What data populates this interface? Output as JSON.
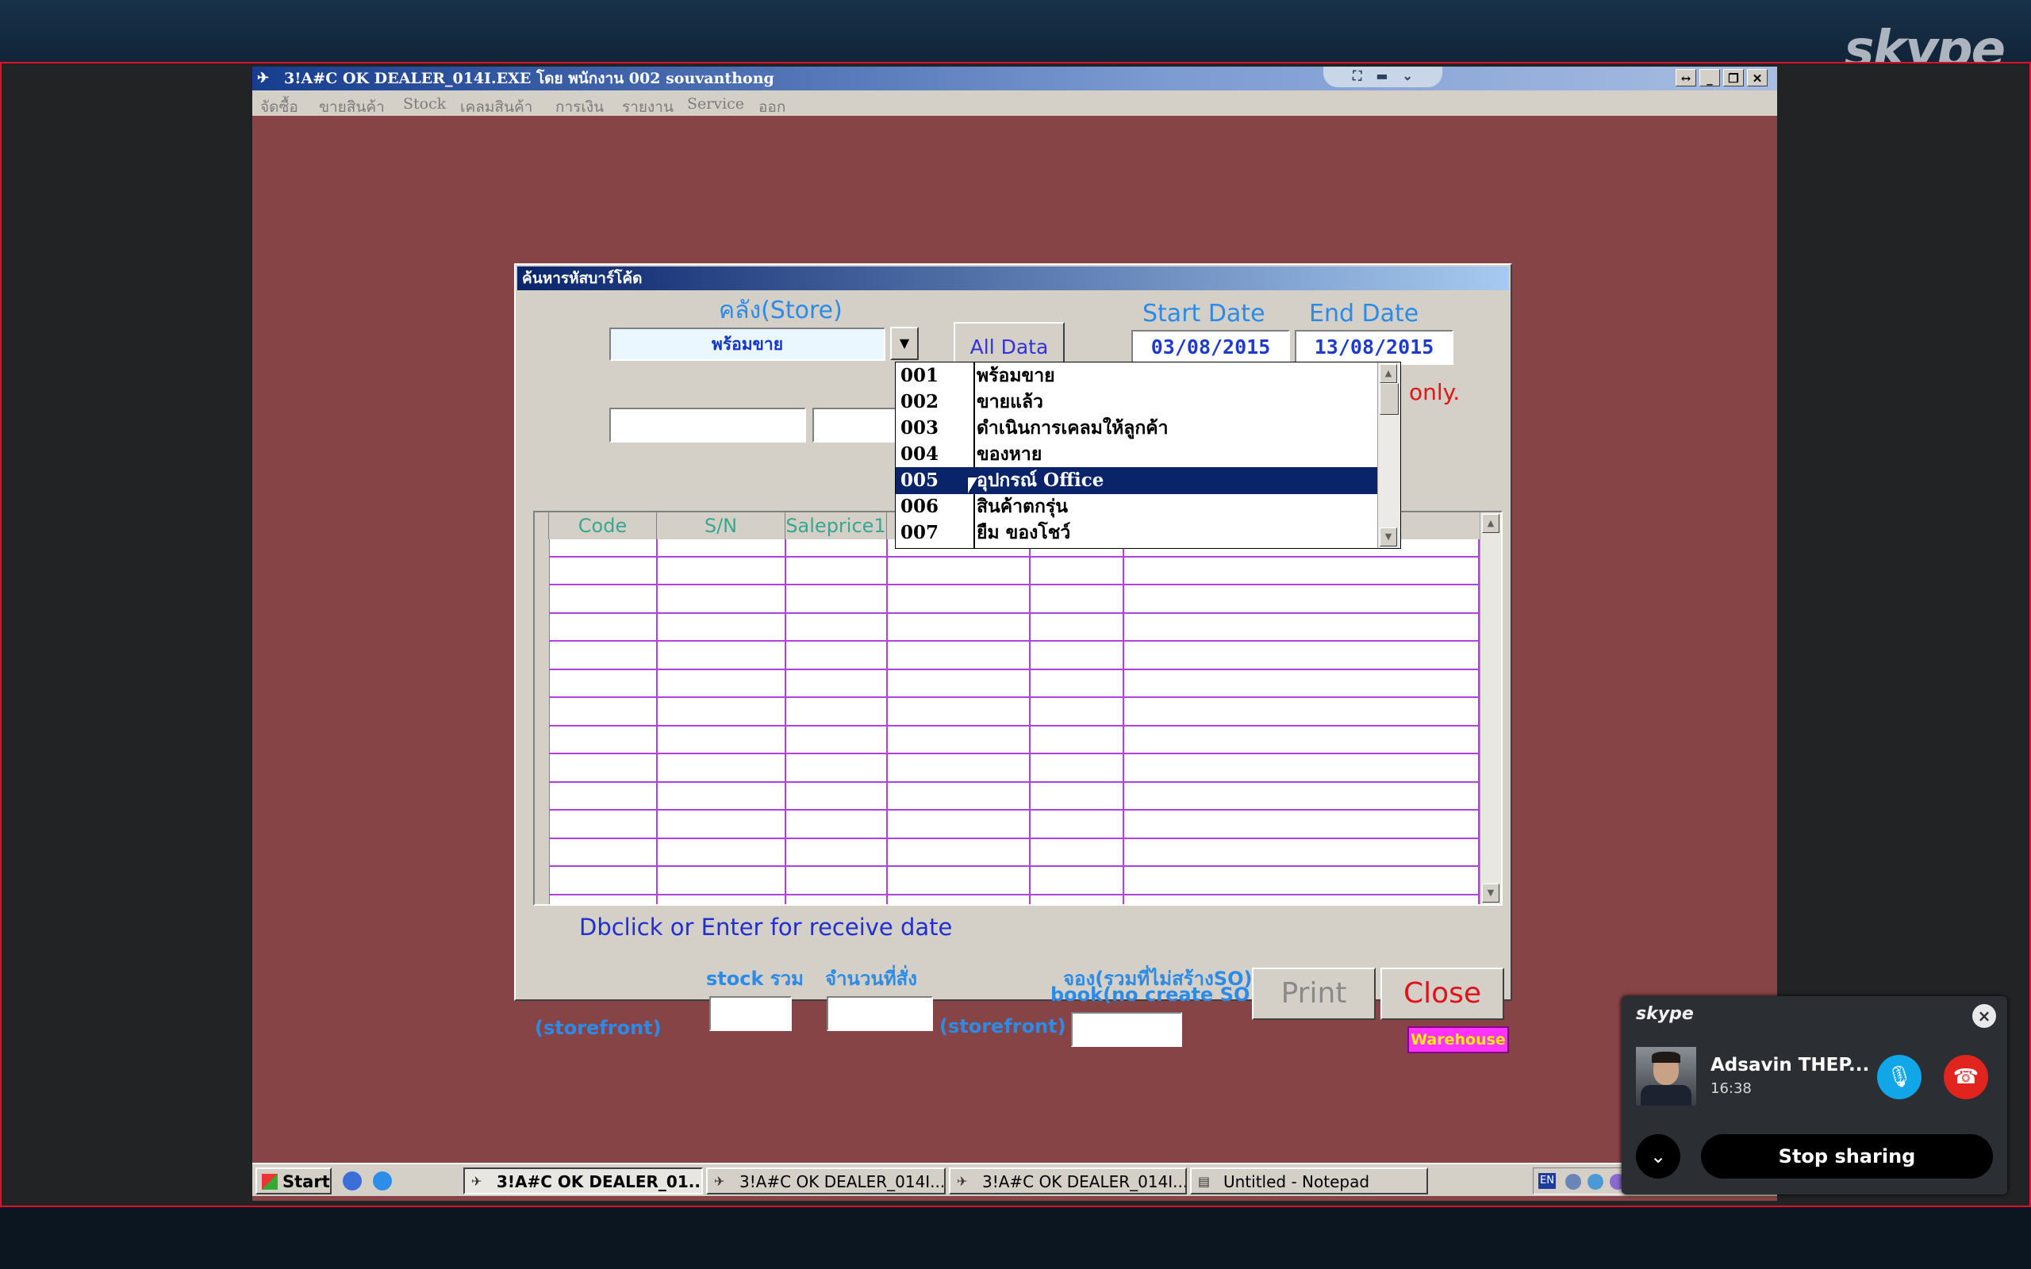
{
  "skype_brand": "skype",
  "app": {
    "title": "3!A#C OK DEALER_014I.EXE โดย พนักงาน 002 souvanthong",
    "menu": [
      "จัดซื้อ",
      "ขายสินค้า",
      "Stock",
      "เคลมสินค้า",
      "การเงิน",
      "รายงาน",
      "Service",
      "ออก"
    ]
  },
  "dialog": {
    "title": "ค้นหารหัสบาร์โค้ด",
    "store_label": "คลัง(Store)",
    "store_value": "พร้อมขาย",
    "all_data_label": "All Data",
    "start_date_label": "Start Date",
    "end_date_label": "End Date",
    "start_date": "03/08/2015",
    "end_date": "13/08/2015",
    "only_label": "only.",
    "grid_columns": [
      "Code",
      "S/N",
      "Saleprice1"
    ],
    "hint": "Dbclick or Enter for receive date",
    "stock_total_label": "stock รวม",
    "order_qty_label": "จำนวนที่สั่ง",
    "booking_label_th": "จอง(รวมที่ไม่สร้างSO)",
    "booking_label_en": "book(no create SO)",
    "storefront_label": "(storefront)",
    "print_label": "Print",
    "close_label": "Close",
    "warehouse_label": "Warehouse"
  },
  "dropdown": {
    "items": [
      {
        "code": "001",
        "name": "พร้อมขาย"
      },
      {
        "code": "002",
        "name": "ขายแล้ว"
      },
      {
        "code": "003",
        "name": "ดำเนินการเคลมให้ลูกค้า"
      },
      {
        "code": "004",
        "name": "ของหาย"
      },
      {
        "code": "005",
        "name": "อุปกรณ์ Office"
      },
      {
        "code": "006",
        "name": "สินค้าตกรุ่น"
      },
      {
        "code": "007",
        "name": "ยืม ของโชว์"
      }
    ],
    "selected_code": "005"
  },
  "taskbar": {
    "start_label": "Start",
    "tasks": [
      {
        "label": "3!A#C OK DEALER_01...",
        "active": true
      },
      {
        "label": "3!A#C OK DEALER_014I...",
        "active": false
      },
      {
        "label": "3!A#C OK DEALER_014I...",
        "active": false
      },
      {
        "label": "Untitled - Notepad",
        "active": false
      }
    ],
    "language": "EN"
  },
  "skype_call": {
    "logo": "skype",
    "caller_name": "Adsavin THEP...",
    "duration": "16:38",
    "stop_sharing_label": "Stop sharing"
  },
  "colors": {
    "desktop_bg": "#874446",
    "dialog_bg": "#d4d0c8",
    "accent_blue": "#2b8be8",
    "selection": "#0a246a",
    "grid_lines": "#b040e0",
    "close_red": "#e2121a",
    "warehouse_bg": "#ff33ff",
    "share_border": "#e0102a"
  }
}
